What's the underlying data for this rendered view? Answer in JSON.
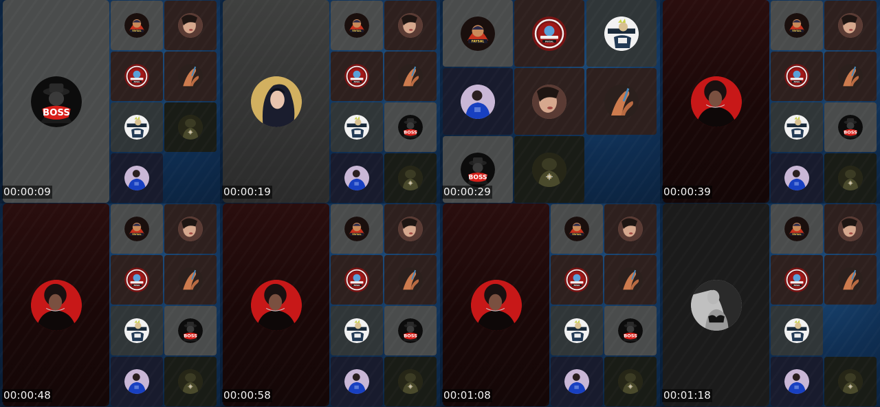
{
  "app": {
    "title": ""
  },
  "theme": {
    "page_bg": "#0a1422",
    "frame_bg": "#0f2e52",
    "timestamp_color": "#f4f4f4"
  },
  "avatars": {
    "boss": {
      "icon": "boss-logo-icon",
      "bg": "#0c0c0c",
      "accent": "#d8201a",
      "text": "BOSS"
    },
    "faysal": {
      "icon": "faysal-badge-icon",
      "bg": "#1a0f0d",
      "accent": "#e43a22",
      "text": "FAYSAL"
    },
    "king": {
      "icon": "king-of-tiktok-badge-icon",
      "bg": "#7a1414",
      "accent": "#e5e5e5",
      "text": "FAYSAL"
    },
    "woman_face": {
      "icon": "woman-face-avatar-icon",
      "bg": "#c9a08a",
      "accent": "#7a4a3a",
      "text": ""
    },
    "hand": {
      "icon": "hand-avatar-icon",
      "bg": "#3a2a26",
      "accent": "#d6865a",
      "text": ""
    },
    "cartoon": {
      "icon": "cartoon-character-avatar-icon",
      "bg": "#ffffff",
      "accent": "#1a2a3a",
      "text": ""
    },
    "soldier": {
      "icon": "soldier-avatar-icon",
      "bg": "#4a4a2a",
      "accent": "#b0a070",
      "text": ""
    },
    "blue_boy": {
      "icon": "blue-shirt-avatar-icon",
      "bg": "#c9b7d6",
      "accent": "#1840c0",
      "text": ""
    },
    "hijab": {
      "icon": "hijab-woman-avatar-icon",
      "bg": "#d2b060",
      "accent": "#1a1d2e",
      "text": ""
    },
    "curly_red": {
      "icon": "curly-hair-red-avatar-icon",
      "bg": "#c81818",
      "accent": "#1a1010",
      "text": ""
    },
    "bw_woman": {
      "icon": "black-white-woman-avatar-icon",
      "bg": "#d8d8d8",
      "accent": "#151515",
      "text": ""
    }
  },
  "frames": [
    {
      "timestamp": "00:00:09",
      "layout": "speaker",
      "main": {
        "avatar": "boss",
        "bg": "bg-gray"
      },
      "tiles": [
        {
          "avatar": "faysal",
          "bg": "bg-gray"
        },
        {
          "avatar": "woman_face",
          "bg": "bg-brown"
        },
        {
          "avatar": "king",
          "bg": "bg-brown"
        },
        {
          "avatar": "hand",
          "bg": "bg-brown"
        },
        {
          "avatar": "cartoon",
          "bg": "bg-slate"
        },
        {
          "avatar": "soldier",
          "bg": "bg-dark"
        },
        {
          "avatar": "blue_boy",
          "bg": "bg-navy"
        }
      ]
    },
    {
      "timestamp": "00:00:19",
      "layout": "speaker",
      "main": {
        "avatar": "hijab",
        "bg": "bg-darkgray"
      },
      "tiles": [
        {
          "avatar": "faysal",
          "bg": "bg-gray"
        },
        {
          "avatar": "woman_face",
          "bg": "bg-brown"
        },
        {
          "avatar": "king",
          "bg": "bg-brown"
        },
        {
          "avatar": "hand",
          "bg": "bg-brown"
        },
        {
          "avatar": "cartoon",
          "bg": "bg-slate"
        },
        {
          "avatar": "boss",
          "bg": "bg-gray"
        },
        {
          "avatar": "blue_boy",
          "bg": "bg-navy"
        },
        {
          "avatar": "soldier",
          "bg": "bg-dark"
        }
      ]
    },
    {
      "timestamp": "00:00:29",
      "layout": "grid3",
      "tiles": [
        {
          "avatar": "faysal",
          "bg": "bg-gray"
        },
        {
          "avatar": "king",
          "bg": "bg-brown"
        },
        {
          "avatar": "cartoon",
          "bg": "bg-slate"
        },
        {
          "avatar": "blue_boy",
          "bg": "bg-navy"
        },
        {
          "avatar": "woman_face",
          "bg": "bg-brown"
        },
        {
          "avatar": "hand",
          "bg": "bg-brown"
        },
        {
          "avatar": "boss",
          "bg": "bg-gray"
        },
        {
          "avatar": "soldier",
          "bg": "bg-dark"
        }
      ]
    },
    {
      "timestamp": "00:00:39",
      "layout": "speaker",
      "main": {
        "avatar": "curly_red",
        "bg": "bg-maroon"
      },
      "tiles": [
        {
          "avatar": "faysal",
          "bg": "bg-gray"
        },
        {
          "avatar": "woman_face",
          "bg": "bg-brown"
        },
        {
          "avatar": "king",
          "bg": "bg-brown"
        },
        {
          "avatar": "hand",
          "bg": "bg-brown"
        },
        {
          "avatar": "cartoon",
          "bg": "bg-slate"
        },
        {
          "avatar": "boss",
          "bg": "bg-gray"
        },
        {
          "avatar": "blue_boy",
          "bg": "bg-navy"
        },
        {
          "avatar": "soldier",
          "bg": "bg-dark"
        }
      ]
    },
    {
      "timestamp": "00:00:48",
      "layout": "speaker",
      "main": {
        "avatar": "curly_red",
        "bg": "bg-maroon"
      },
      "tiles": [
        {
          "avatar": "faysal",
          "bg": "bg-gray"
        },
        {
          "avatar": "woman_face",
          "bg": "bg-brown"
        },
        {
          "avatar": "king",
          "bg": "bg-brown"
        },
        {
          "avatar": "hand",
          "bg": "bg-brown"
        },
        {
          "avatar": "cartoon",
          "bg": "bg-slate"
        },
        {
          "avatar": "boss",
          "bg": "bg-gray"
        },
        {
          "avatar": "blue_boy",
          "bg": "bg-navy"
        },
        {
          "avatar": "soldier",
          "bg": "bg-dark"
        }
      ]
    },
    {
      "timestamp": "00:00:58",
      "layout": "speaker",
      "main": {
        "avatar": "curly_red",
        "bg": "bg-maroon"
      },
      "tiles": [
        {
          "avatar": "faysal",
          "bg": "bg-gray"
        },
        {
          "avatar": "woman_face",
          "bg": "bg-brown"
        },
        {
          "avatar": "king",
          "bg": "bg-brown"
        },
        {
          "avatar": "hand",
          "bg": "bg-brown"
        },
        {
          "avatar": "cartoon",
          "bg": "bg-slate"
        },
        {
          "avatar": "boss",
          "bg": "bg-gray"
        },
        {
          "avatar": "blue_boy",
          "bg": "bg-navy"
        },
        {
          "avatar": "soldier",
          "bg": "bg-dark"
        }
      ]
    },
    {
      "timestamp": "00:01:08",
      "layout": "speaker",
      "main": {
        "avatar": "curly_red",
        "bg": "bg-maroon"
      },
      "tiles": [
        {
          "avatar": "faysal",
          "bg": "bg-gray"
        },
        {
          "avatar": "woman_face",
          "bg": "bg-brown"
        },
        {
          "avatar": "king",
          "bg": "bg-brown"
        },
        {
          "avatar": "hand",
          "bg": "bg-brown"
        },
        {
          "avatar": "cartoon",
          "bg": "bg-slate"
        },
        {
          "avatar": "boss",
          "bg": "bg-gray"
        },
        {
          "avatar": "blue_boy",
          "bg": "bg-navy"
        },
        {
          "avatar": "soldier",
          "bg": "bg-dark"
        }
      ]
    },
    {
      "timestamp": "00:01:18",
      "layout": "speaker",
      "main": {
        "avatar": "bw_woman",
        "bg": "bg-black"
      },
      "tiles": [
        {
          "avatar": "faysal",
          "bg": "bg-gray"
        },
        {
          "avatar": "woman_face",
          "bg": "bg-brown"
        },
        {
          "avatar": "king",
          "bg": "bg-brown"
        },
        {
          "avatar": "hand",
          "bg": "bg-brown"
        },
        {
          "avatar": "cartoon",
          "bg": "bg-slate"
        },
        null,
        {
          "avatar": "blue_boy",
          "bg": "bg-navy"
        },
        {
          "avatar": "soldier",
          "bg": "bg-dark"
        }
      ]
    }
  ]
}
